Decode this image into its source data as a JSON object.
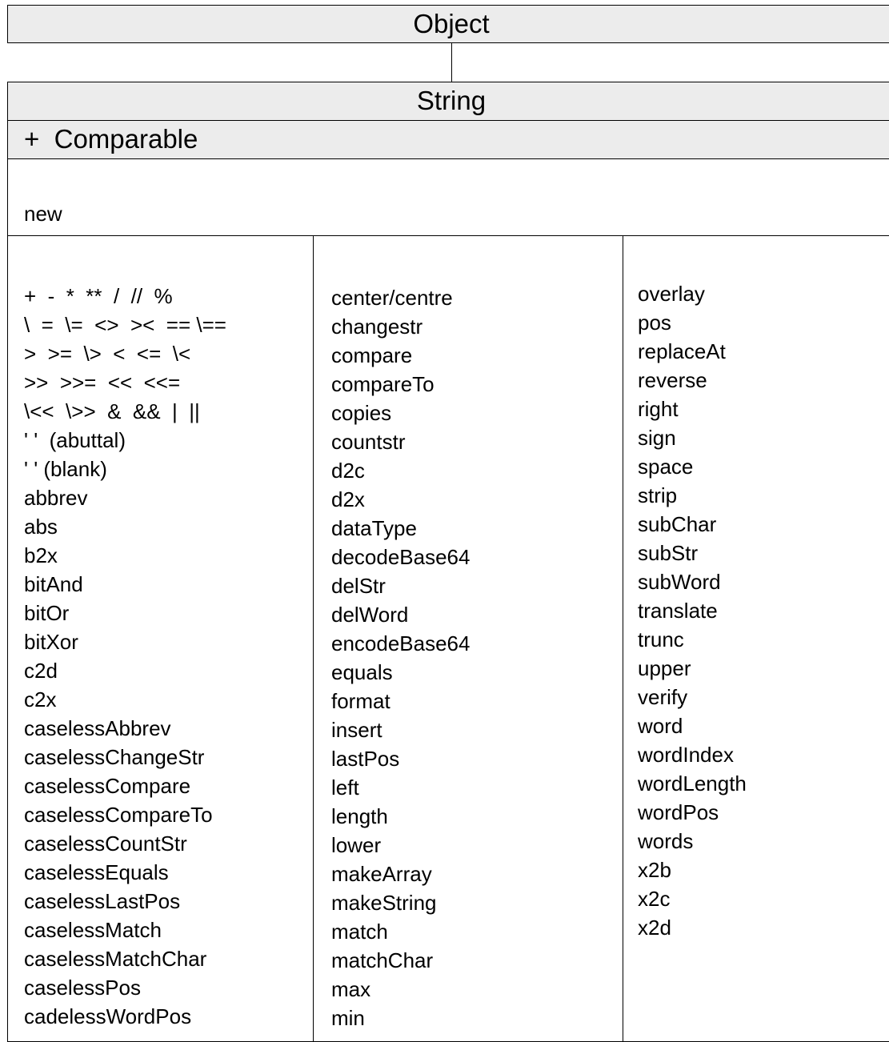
{
  "parent_class": "Object",
  "class_name": "String",
  "mixin": "+  Comparable",
  "class_methods": [
    "new"
  ],
  "instance_methods": {
    "column1": [
      "+  -  *  **  /  //  %",
      "\\  =  \\=  <>  ><  == \\==",
      ">  >=  \\>  <  <=  \\<",
      ">>  >>=  <<  <<=",
      "\\<<  \\>>  &  &&  |  ||",
      "' '  (abuttal)",
      "' ' (blank)",
      "abbrev",
      "abs",
      "b2x",
      "bitAnd",
      "bitOr",
      "bitXor",
      "c2d",
      "c2x",
      "caselessAbbrev",
      "caselessChangeStr",
      "caselessCompare",
      "caselessCompareTo",
      "caselessCountStr",
      "caselessEquals",
      "caselessLastPos",
      "caselessMatch",
      "caselessMatchChar",
      "caselessPos",
      "cadelessWordPos"
    ],
    "column2": [
      "center/centre",
      "changestr",
      "compare",
      "compareTo",
      "copies",
      "countstr",
      "d2c",
      "d2x",
      "dataType",
      "decodeBase64",
      "delStr",
      "delWord",
      "encodeBase64",
      "equals",
      "format",
      "insert",
      "lastPos",
      "left",
      "length",
      "lower",
      "makeArray",
      "makeString",
      "match",
      "matchChar",
      "max",
      "min"
    ],
    "column3": [
      "overlay",
      "pos",
      "replaceAt",
      "reverse",
      "right",
      "sign",
      "space",
      "strip",
      "subChar",
      "subStr",
      "subWord",
      "translate",
      "trunc",
      "upper",
      "verify",
      "word",
      "wordIndex",
      "wordLength",
      "wordPos",
      "words",
      "x2b",
      "x2c",
      "x2d"
    ]
  },
  "colors": {
    "header_fill": "#ececec",
    "border": "#000000",
    "background": "#ffffff"
  }
}
